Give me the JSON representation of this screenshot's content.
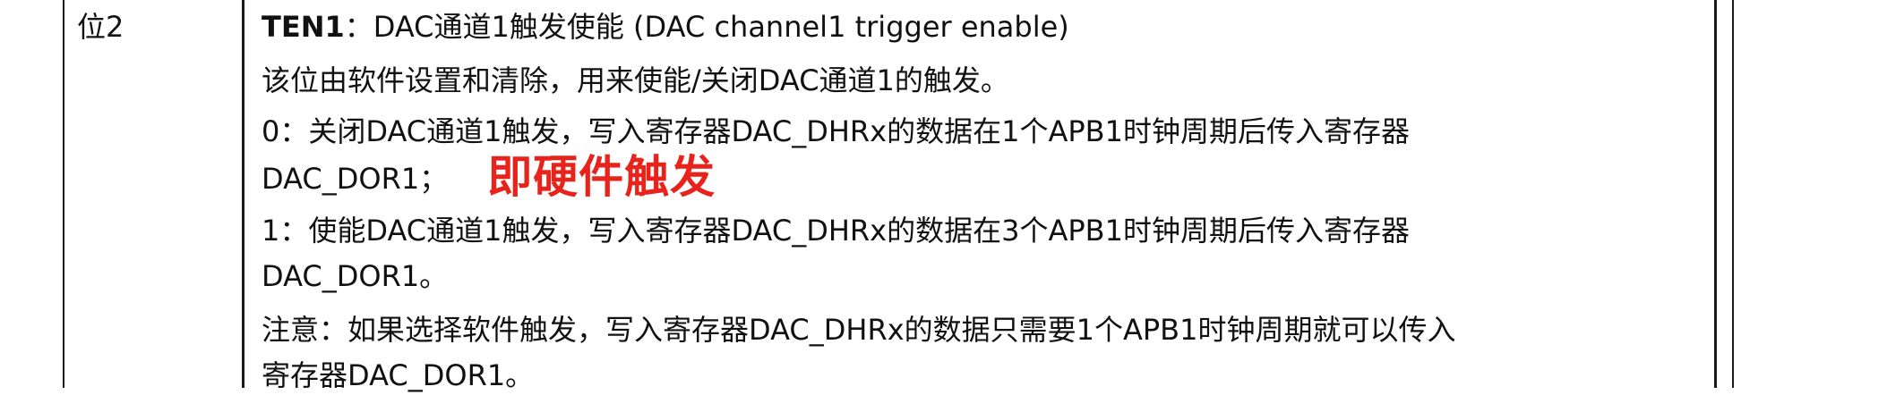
{
  "row": {
    "bit": "位2",
    "field_name": "TEN1",
    "field_colon": "：",
    "field_title": "DAC通道1触发使能 (DAC channel1 trigger enable)",
    "line_desc": "该位由软件设置和清除，用来使能/关闭DAC通道1的触发。",
    "line_0a": "0：关闭DAC通道1触发，写入寄存器DAC_DHRx的数据在1个APB1时钟周期后传入寄存器",
    "line_0b": "DAC_DOR1；",
    "annotation": "即硬件触发",
    "annotation_color": "#e8231b",
    "line_1a": "1：使能DAC通道1触发，写入寄存器DAC_DHRx的数据在3个APB1时钟周期后传入寄存器",
    "line_1b": "DAC_DOR1。",
    "note_a": "注意：如果选择软件触发，写入寄存器DAC_DHRx的数据只需要1个APB1时钟周期就可以传入",
    "note_b": "寄存器DAC_DOR1。"
  }
}
